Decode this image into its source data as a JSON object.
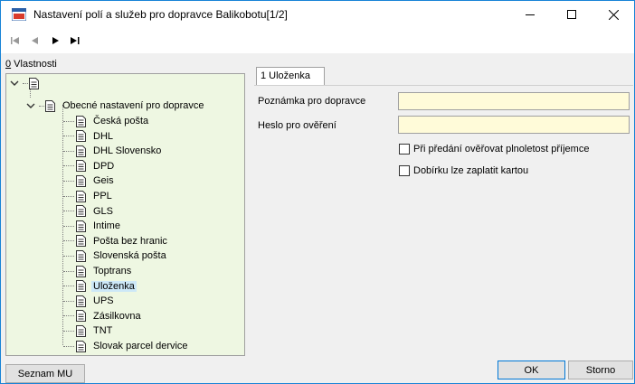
{
  "window": {
    "title": "Nastavení polí a služeb pro dopravce Balikobotu[1/2]",
    "app_icon": "kz-app-icon",
    "controls": {
      "minimize": "minimize-icon",
      "maximize": "maximize-icon",
      "close": "close-icon"
    }
  },
  "toolbar": {
    "nav": [
      {
        "name": "first-record-icon"
      },
      {
        "name": "previous-record-icon"
      },
      {
        "name": "next-record-icon"
      },
      {
        "name": "last-record-icon"
      }
    ]
  },
  "properties": {
    "label": "0 Vlastnosti",
    "tree": {
      "root_label": "",
      "group_label": "Obecné nastavení pro dopravce",
      "items": [
        "Česká pošta",
        "DHL",
        "DHL Slovensko",
        "DPD",
        "Geis",
        "PPL",
        "GLS",
        "Intime",
        "Pošta bez hranic",
        "Slovenská pošta",
        "Toptrans",
        "Uloženka",
        "UPS",
        "Zásilkovna",
        "TNT",
        "Slovak parcel dervice"
      ],
      "selected": "Uloženka"
    }
  },
  "tab": {
    "label": "1 Uloženka"
  },
  "form": {
    "fields": [
      {
        "label": "Poznámka pro dopravce",
        "value": ""
      },
      {
        "label": "Heslo pro ověření",
        "value": ""
      }
    ],
    "checkboxes": [
      {
        "label": "Při předání ověřovat plnoletost příjemce",
        "checked": false
      },
      {
        "label": "Dobírku lze zaplatit kartou",
        "checked": false
      }
    ]
  },
  "buttons": {
    "seznam": "Seznam MU",
    "ok": "OK",
    "storno": "Storno"
  },
  "colors": {
    "tree_bg": "#eef7e2",
    "input_bg": "#fffbd9",
    "selection": "#cde8f7",
    "accent": "#0078d7"
  }
}
